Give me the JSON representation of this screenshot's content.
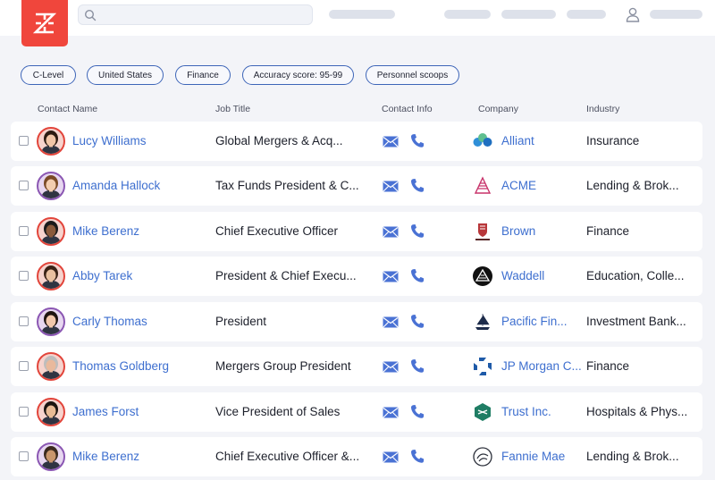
{
  "filters": [
    "C-Level",
    "United States",
    "Finance",
    "Accuracy score: 95-99",
    "Personnel scoops"
  ],
  "columns": {
    "contact_name": "Contact Name",
    "job_title": "Job Title",
    "contact_info": "Contact Info",
    "company": "Company",
    "industry": "Industry"
  },
  "contacts": [
    {
      "name": "Lucy Williams",
      "title": "Global Mergers & Acq...",
      "company": "Alliant",
      "industry": "Insurance",
      "company_icon": "alliant-logo-icon"
    },
    {
      "name": "Amanda Hallock",
      "title": "Tax Funds President & C...",
      "company": "ACME",
      "industry": "Lending & Brok...",
      "company_icon": "acme-logo-icon"
    },
    {
      "name": "Mike Berenz",
      "title": "Chief Executive Officer",
      "company": "Brown",
      "industry": "Finance",
      "company_icon": "brown-logo-icon"
    },
    {
      "name": "Abby Tarek",
      "title": "President & Chief Execu...",
      "company": "Waddell",
      "industry": "Education, Colle...",
      "company_icon": "waddell-logo-icon"
    },
    {
      "name": "Carly Thomas",
      "title": "President",
      "company": "Pacific Fin...",
      "industry": "Investment Bank...",
      "company_icon": "pacific-ship-logo-icon"
    },
    {
      "name": "Thomas Goldberg",
      "title": "Mergers Group President",
      "company": "JP Morgan C...",
      "industry": "Finance",
      "company_icon": "jpmorgan-logo-icon"
    },
    {
      "name": "James Forst",
      "title": "Vice President of Sales",
      "company": "Trust Inc.",
      "industry": "Hospitals & Phys...",
      "company_icon": "trust-logo-icon"
    },
    {
      "name": "Mike Berenz",
      "title": "Chief Executive Officer &...",
      "company": "Fannie Mae",
      "industry": "Lending & Brok...",
      "company_icon": "fannie-mae-logo-icon"
    }
  ],
  "colors": {
    "brand": "#f0463c",
    "link": "#3e6fcf",
    "chip_border": "#3d65b8",
    "icon_blue": "#4a72d4"
  }
}
